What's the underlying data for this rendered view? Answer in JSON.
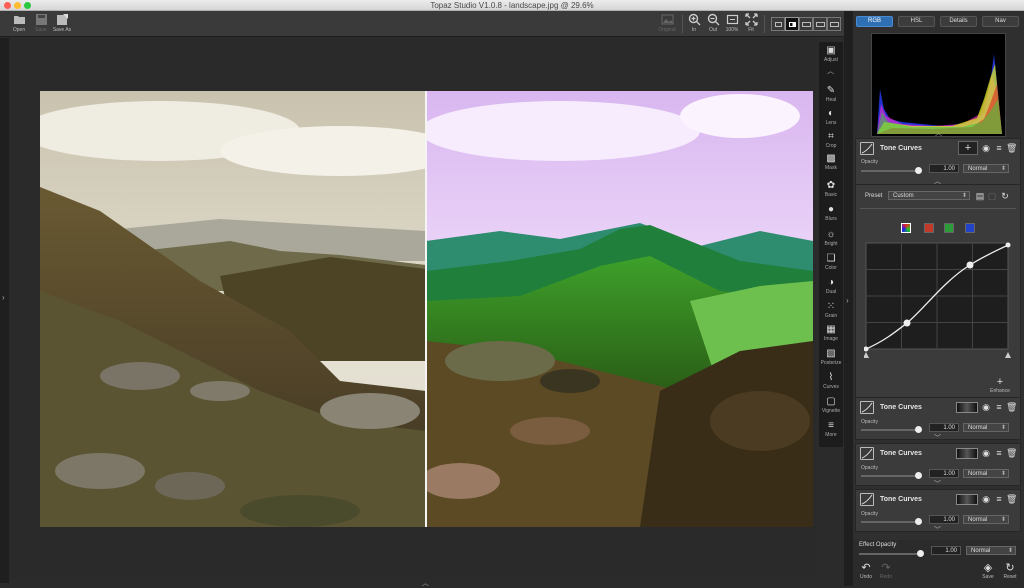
{
  "window": {
    "title": "Topaz Studio V1.0.8 - landscape.jpg @ 29.6%"
  },
  "toolbar": {
    "open": "Open",
    "save": "Save",
    "save_as": "Save As",
    "original": "Original",
    "zoom_in": "In",
    "zoom_out": "Out",
    "zoom_100": "100%",
    "fit": "Fit"
  },
  "tools": [
    {
      "label": "Adjust",
      "icon": "adjust-icon"
    },
    {
      "label": "Heal",
      "icon": "bandage-icon"
    },
    {
      "label": "Lens",
      "icon": "lens-icon"
    },
    {
      "label": "Crop",
      "icon": "crop-icon"
    },
    {
      "label": "Mask",
      "icon": "mask-icon"
    },
    {
      "label": "Basic",
      "icon": "basic-icon"
    },
    {
      "label": "Blurs",
      "icon": "blur-icon"
    },
    {
      "label": "Bright",
      "icon": "sun-icon"
    },
    {
      "label": "Color",
      "icon": "color-icon"
    },
    {
      "label": "Dual",
      "icon": "dual-icon"
    },
    {
      "label": "Grain",
      "icon": "grain-icon"
    },
    {
      "label": "Image",
      "icon": "image-icon"
    },
    {
      "label": "Posterize",
      "icon": "posterize-icon"
    },
    {
      "label": "Curves",
      "icon": "curves-icon"
    },
    {
      "label": "Vignette",
      "icon": "vignette-icon"
    },
    {
      "label": "More",
      "icon": "more-icon"
    }
  ],
  "panel": {
    "tabs": [
      "RGB",
      "HSL",
      "Details",
      "Nav"
    ],
    "active_tab": "RGB",
    "main_card": {
      "title": "Tone Curves",
      "opacity_label": "Opacity",
      "opacity_value": "1.00",
      "blend": "Normal",
      "preset_label": "Preset",
      "preset_value": "Custom",
      "enhance_label": "Enhance",
      "opacity": 1.0
    },
    "cards": [
      {
        "title": "Tone Curves",
        "opacity_label": "Opacity",
        "opacity_value": "1.00",
        "blend": "Normal"
      },
      {
        "title": "Tone Curves",
        "opacity_label": "Opacity",
        "opacity_value": "1.00",
        "blend": "Normal"
      },
      {
        "title": "Tone Curves",
        "opacity_label": "Opacity",
        "opacity_value": "1.00",
        "blend": "Normal"
      }
    ],
    "effect_opacity_label": "Effect Opacity",
    "effect_opacity_value": "1.00",
    "effect_blend": "Normal",
    "bottom": {
      "undo": "Undo",
      "redo": "Redo",
      "save": "Save",
      "reset": "Reset"
    }
  },
  "colors": {
    "accent": "#2f6fb3",
    "red": "#c0392b",
    "green": "#2e9b3a",
    "blue": "#2343c8"
  }
}
